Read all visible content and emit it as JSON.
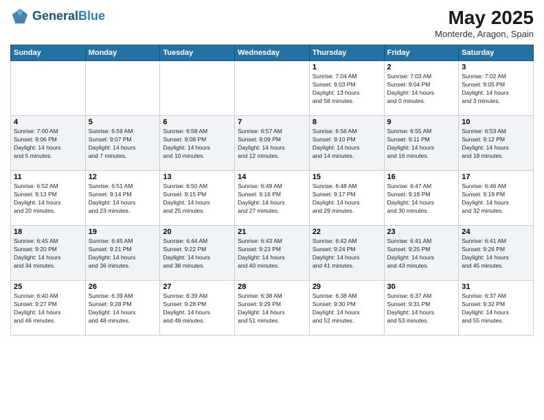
{
  "header": {
    "logo_line1": "General",
    "logo_line2": "Blue",
    "month": "May 2025",
    "location": "Monterde, Aragon, Spain"
  },
  "weekdays": [
    "Sunday",
    "Monday",
    "Tuesday",
    "Wednesday",
    "Thursday",
    "Friday",
    "Saturday"
  ],
  "weeks": [
    [
      {
        "day": "",
        "info": ""
      },
      {
        "day": "",
        "info": ""
      },
      {
        "day": "",
        "info": ""
      },
      {
        "day": "",
        "info": ""
      },
      {
        "day": "1",
        "info": "Sunrise: 7:04 AM\nSunset: 9:03 PM\nDaylight: 13 hours\nand 58 minutes."
      },
      {
        "day": "2",
        "info": "Sunrise: 7:03 AM\nSunset: 9:04 PM\nDaylight: 14 hours\nand 0 minutes."
      },
      {
        "day": "3",
        "info": "Sunrise: 7:02 AM\nSunset: 9:05 PM\nDaylight: 14 hours\nand 3 minutes."
      }
    ],
    [
      {
        "day": "4",
        "info": "Sunrise: 7:00 AM\nSunset: 9:06 PM\nDaylight: 14 hours\nand 5 minutes."
      },
      {
        "day": "5",
        "info": "Sunrise: 6:59 AM\nSunset: 9:07 PM\nDaylight: 14 hours\nand 7 minutes."
      },
      {
        "day": "6",
        "info": "Sunrise: 6:58 AM\nSunset: 9:08 PM\nDaylight: 14 hours\nand 10 minutes."
      },
      {
        "day": "7",
        "info": "Sunrise: 6:57 AM\nSunset: 9:09 PM\nDaylight: 14 hours\nand 12 minutes."
      },
      {
        "day": "8",
        "info": "Sunrise: 6:56 AM\nSunset: 9:10 PM\nDaylight: 14 hours\nand 14 minutes."
      },
      {
        "day": "9",
        "info": "Sunrise: 6:55 AM\nSunset: 9:11 PM\nDaylight: 14 hours\nand 16 minutes."
      },
      {
        "day": "10",
        "info": "Sunrise: 6:53 AM\nSunset: 9:12 PM\nDaylight: 14 hours\nand 18 minutes."
      }
    ],
    [
      {
        "day": "11",
        "info": "Sunrise: 6:52 AM\nSunset: 9:13 PM\nDaylight: 14 hours\nand 20 minutes."
      },
      {
        "day": "12",
        "info": "Sunrise: 6:51 AM\nSunset: 9:14 PM\nDaylight: 14 hours\nand 23 minutes."
      },
      {
        "day": "13",
        "info": "Sunrise: 6:50 AM\nSunset: 9:15 PM\nDaylight: 14 hours\nand 25 minutes."
      },
      {
        "day": "14",
        "info": "Sunrise: 6:49 AM\nSunset: 9:16 PM\nDaylight: 14 hours\nand 27 minutes."
      },
      {
        "day": "15",
        "info": "Sunrise: 6:48 AM\nSunset: 9:17 PM\nDaylight: 14 hours\nand 29 minutes."
      },
      {
        "day": "16",
        "info": "Sunrise: 6:47 AM\nSunset: 9:18 PM\nDaylight: 14 hours\nand 30 minutes."
      },
      {
        "day": "17",
        "info": "Sunrise: 6:46 AM\nSunset: 9:19 PM\nDaylight: 14 hours\nand 32 minutes."
      }
    ],
    [
      {
        "day": "18",
        "info": "Sunrise: 6:45 AM\nSunset: 9:20 PM\nDaylight: 14 hours\nand 34 minutes."
      },
      {
        "day": "19",
        "info": "Sunrise: 6:45 AM\nSunset: 9:21 PM\nDaylight: 14 hours\nand 36 minutes."
      },
      {
        "day": "20",
        "info": "Sunrise: 6:44 AM\nSunset: 9:22 PM\nDaylight: 14 hours\nand 38 minutes."
      },
      {
        "day": "21",
        "info": "Sunrise: 6:43 AM\nSunset: 9:23 PM\nDaylight: 14 hours\nand 40 minutes."
      },
      {
        "day": "22",
        "info": "Sunrise: 6:42 AM\nSunset: 9:24 PM\nDaylight: 14 hours\nand 41 minutes."
      },
      {
        "day": "23",
        "info": "Sunrise: 6:41 AM\nSunset: 9:25 PM\nDaylight: 14 hours\nand 43 minutes."
      },
      {
        "day": "24",
        "info": "Sunrise: 6:41 AM\nSunset: 9:26 PM\nDaylight: 14 hours\nand 45 minutes."
      }
    ],
    [
      {
        "day": "25",
        "info": "Sunrise: 6:40 AM\nSunset: 9:27 PM\nDaylight: 14 hours\nand 46 minutes."
      },
      {
        "day": "26",
        "info": "Sunrise: 6:39 AM\nSunset: 9:28 PM\nDaylight: 14 hours\nand 48 minutes."
      },
      {
        "day": "27",
        "info": "Sunrise: 6:39 AM\nSunset: 9:28 PM\nDaylight: 14 hours\nand 49 minutes."
      },
      {
        "day": "28",
        "info": "Sunrise: 6:38 AM\nSunset: 9:29 PM\nDaylight: 14 hours\nand 51 minutes."
      },
      {
        "day": "29",
        "info": "Sunrise: 6:38 AM\nSunset: 9:30 PM\nDaylight: 14 hours\nand 52 minutes."
      },
      {
        "day": "30",
        "info": "Sunrise: 6:37 AM\nSunset: 9:31 PM\nDaylight: 14 hours\nand 53 minutes."
      },
      {
        "day": "31",
        "info": "Sunrise: 6:37 AM\nSunset: 9:32 PM\nDaylight: 14 hours\nand 55 minutes."
      }
    ]
  ]
}
